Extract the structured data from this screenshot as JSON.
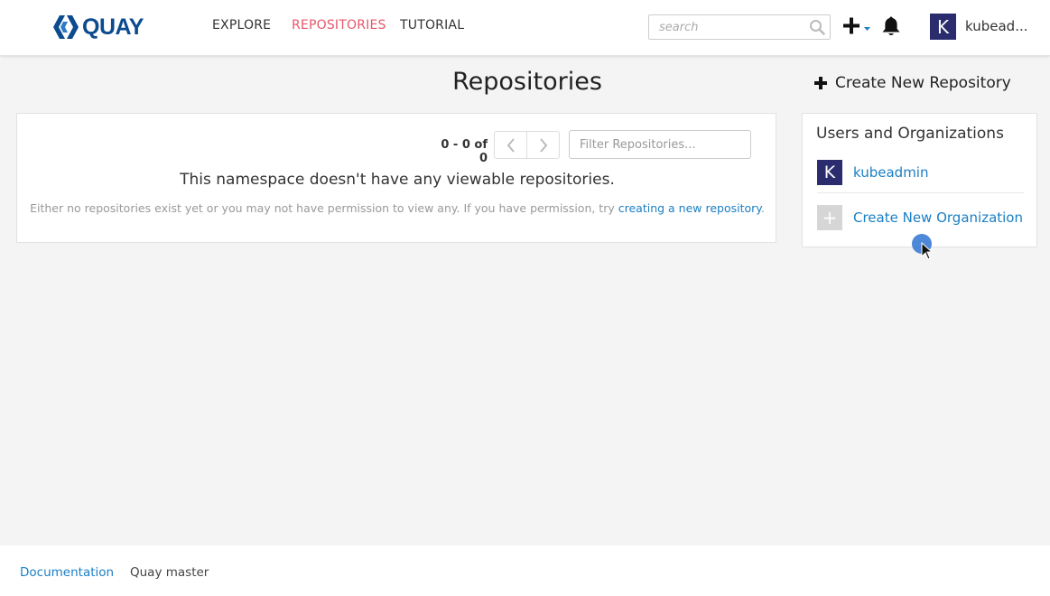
{
  "header": {
    "brand": "QUAY",
    "nav": [
      {
        "label": "EXPLORE",
        "active": false
      },
      {
        "label": "REPOSITORIES",
        "active": true
      },
      {
        "label": "TUTORIAL",
        "active": false
      }
    ],
    "search_placeholder": "search",
    "plus_icon": "plus-dropdown-icon",
    "bell_icon": "bell-icon",
    "user": {
      "avatar_letter": "K",
      "name": "kubead..."
    }
  },
  "page": {
    "title": "Repositories",
    "create_repo_label": "Create New Repository"
  },
  "main": {
    "pager_count": "0 - 0 of 0",
    "filter_placeholder": "Filter Repositories...",
    "empty_heading": "This namespace doesn't have any viewable repositories.",
    "empty_desc_prefix": "Either no repositories exist yet or you may not have permission to view any. If you have permission, try ",
    "empty_desc_link": "creating a new repository",
    "empty_desc_suffix": "."
  },
  "sidebar": {
    "title": "Users and Organizations",
    "user": {
      "avatar_letter": "K",
      "label": "kubeadmin"
    },
    "create_org": {
      "icon_glyph": "+",
      "label": "Create New Organization"
    }
  },
  "footer": {
    "doc_link": "Documentation",
    "version": "Quay master"
  },
  "colors": {
    "accent_link": "#1a7fc4",
    "active_nav": "#e8566a",
    "brand_blue": "#0d4b8f",
    "avatar_bg": "#2b2c6d"
  }
}
